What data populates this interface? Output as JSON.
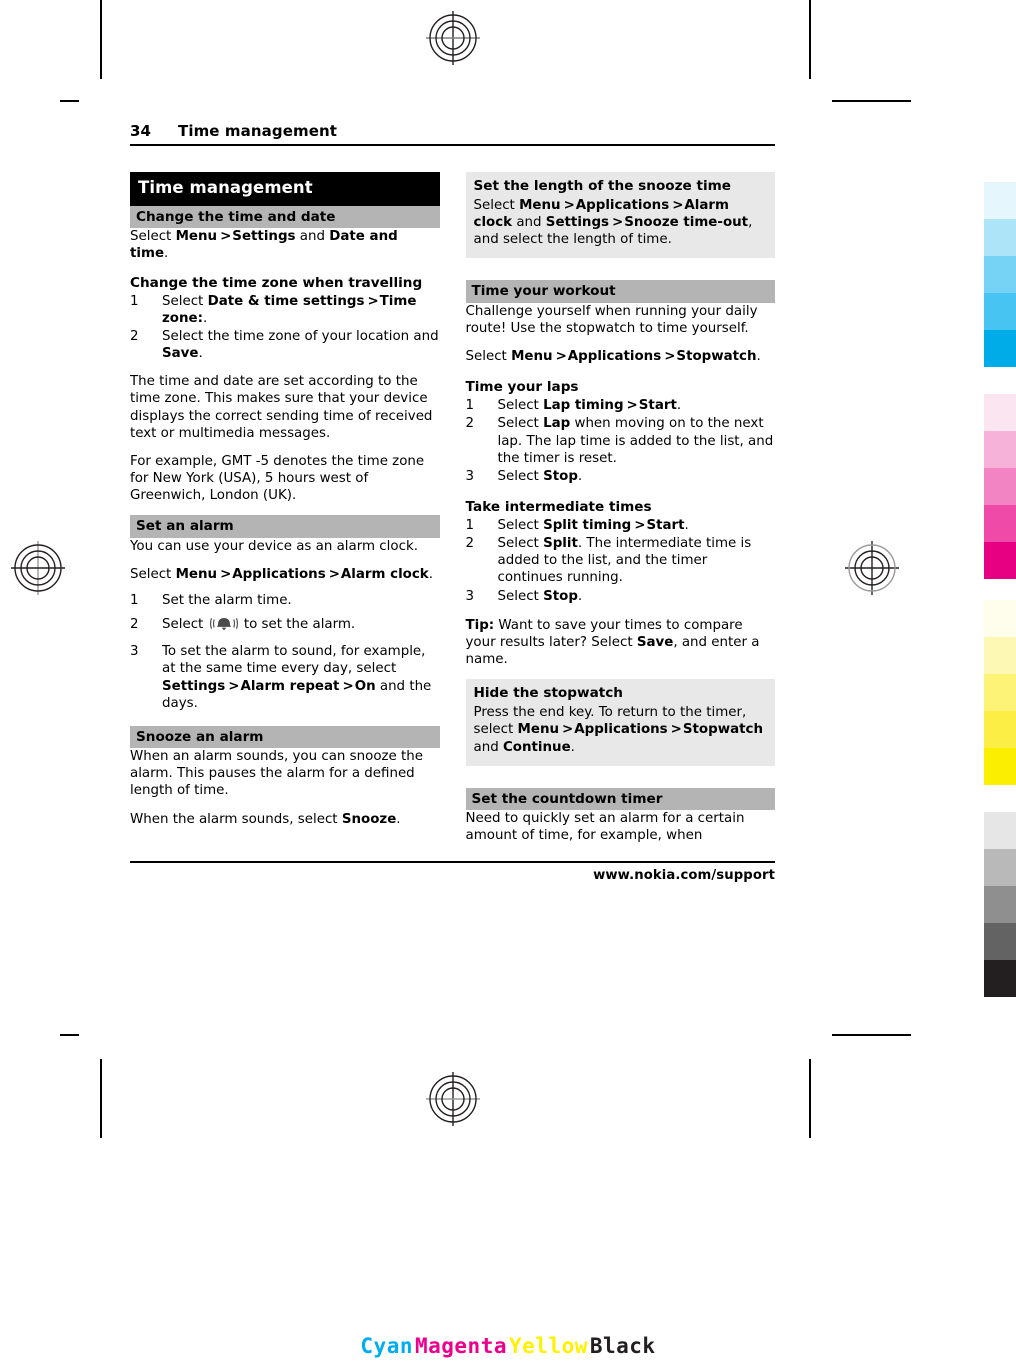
{
  "document": {
    "running_head": {
      "folio": "34",
      "title": "Time management"
    },
    "footer_url": "www.nokia.com/support"
  },
  "left_column": {
    "chapter_title": "Time management",
    "sections": [
      {
        "id": "change-the-time-and-date",
        "heading": "Change the time and date",
        "body_prefix": "Select ",
        "body_b1": "Menu",
        "body_gt1": ">",
        "body_b2": "Settings",
        "body_mid": " and ",
        "body_b3": "Date and time",
        "body_suffix": "."
      }
    ],
    "travel_task": {
      "heading": "Change the time zone when travelling",
      "steps": [
        {
          "num": "1",
          "pre": "Select ",
          "b1": "Date & time settings",
          "gt": ">",
          "b2": "Time zone:",
          "post": "."
        },
        {
          "num": "2",
          "pre": "Select the time zone of your location and ",
          "b1": "Save",
          "post": "."
        }
      ],
      "para1": "The time and date are set according to the time zone. This makes sure that your device displays the correct sending time of received text or multimedia messages.",
      "para2": "For example, GMT -5 denotes the time zone for New York (USA), 5 hours west of Greenwich, London (UK)."
    },
    "set_alarm": {
      "heading": "Set an alarm",
      "para1": "You can use your device as an alarm clock.",
      "para2_pre": "Select ",
      "para2_b1": "Menu",
      "para2_gt1": ">",
      "para2_b2": "Applications",
      "para2_gt2": ">",
      "para2_b3": "Alarm clock",
      "para2_post": ".",
      "steps": [
        {
          "num": "1",
          "text": "Set the alarm time."
        },
        {
          "num": "2",
          "pre": "Select ",
          "icon": "alarm-bell-icon",
          "post": " to set the alarm."
        },
        {
          "num": "3",
          "pre": "To set the alarm to sound, for example, at the same time every day, select ",
          "b1": "Settings",
          "gt1": ">",
          "b2": "Alarm repeat",
          "gt2": ">",
          "b3": "On",
          "post": " and the days."
        }
      ]
    },
    "snooze_alarm": {
      "heading": "Snooze an alarm",
      "para1": "When an alarm sounds, you can snooze the alarm. This pauses the alarm for a defined length of time.",
      "para2_pre": "When the alarm sounds, select ",
      "para2_b1": "Snooze",
      "para2_post": "."
    }
  },
  "right_column": {
    "snooze_length": {
      "heading": "Set the length of the snooze time",
      "pre": "Select ",
      "b1": "Menu",
      "gt1": ">",
      "b2": "Applications",
      "gt2": ">",
      "b3": "Alarm clock",
      "mid": " and ",
      "b4": "Settings",
      "gt3": ">",
      "b5": "Snooze time-out",
      "post": ", and select the length of time."
    },
    "time_workout": {
      "heading": "Time your workout",
      "para1": "Challenge yourself when running your daily route! Use the stopwatch to time yourself.",
      "para2_pre": "Select ",
      "para2_b1": "Menu",
      "para2_gt1": ">",
      "para2_b2": "Applications",
      "para2_gt2": ">",
      "para2_b3": "Stopwatch",
      "para2_post": "."
    },
    "time_laps": {
      "heading": "Time your laps",
      "steps": [
        {
          "num": "1",
          "pre": "Select ",
          "b1": "Lap timing",
          "gt": ">",
          "b2": "Start",
          "post": "."
        },
        {
          "num": "2",
          "pre": "Select ",
          "b1": "Lap",
          "post": " when moving on to the next lap. The lap time is added to the list, and the timer is reset."
        },
        {
          "num": "3",
          "pre": "Select ",
          "b1": "Stop",
          "post": "."
        }
      ]
    },
    "intermediate_times": {
      "heading": "Take intermediate times",
      "steps": [
        {
          "num": "1",
          "pre": "Select ",
          "b1": "Split timing",
          "gt": ">",
          "b2": "Start",
          "post": "."
        },
        {
          "num": "2",
          "pre": "Select ",
          "b1": "Split",
          "post": ". The intermediate time is added to the list, and the timer continues running."
        },
        {
          "num": "3",
          "pre": "Select ",
          "b1": "Stop",
          "post": "."
        }
      ]
    },
    "tip": {
      "label": "Tip:",
      "pre": " Want to save your times to compare your results later? Select ",
      "b1": "Save",
      "post": ", and enter a name."
    },
    "hide_stopwatch": {
      "heading": "Hide the stopwatch",
      "pre": "Press the end key. To return to the timer, select ",
      "b1": "Menu",
      "gt1": ">",
      "b2": "Applications",
      "gt2": ">",
      "b3": "Stopwatch",
      "mid": " and ",
      "b4": "Continue",
      "post": "."
    },
    "countdown_timer": {
      "heading": "Set the countdown timer",
      "para1": "Need to quickly set an alarm for a certain amount of time, for example, when"
    }
  },
  "cmyk_legend": [
    {
      "label": "Cyan",
      "color": "#00aeef"
    },
    {
      "label": "Magenta",
      "color": "#ec008c"
    },
    {
      "label": "Yellow",
      "color": "#fff200"
    },
    {
      "label": "Black",
      "color": "#231f20"
    }
  ],
  "swatch_strip": {
    "cyan": [
      "#e6f6fd",
      "#ade4f8",
      "#77d3f5",
      "#47c4f2",
      "#00ace8"
    ],
    "magenta": [
      "#fae5f1",
      "#f7b2d9",
      "#f284c4",
      "#ef4aa8",
      "#e80083"
    ],
    "yellow": [
      "#fffdec",
      "#fdf8b3",
      "#fdf477",
      "#fdee45",
      "#fbee00"
    ],
    "grey": [
      "#e6e6e6",
      "#b9b9b9",
      "#8f8f8f",
      "#636363",
      "#231f20"
    ]
  },
  "colors": {
    "chapter_bar_bg": "#000000",
    "section_bar_bg": "#b4b4b4",
    "tint_box_bg": "#e8e8e8"
  }
}
